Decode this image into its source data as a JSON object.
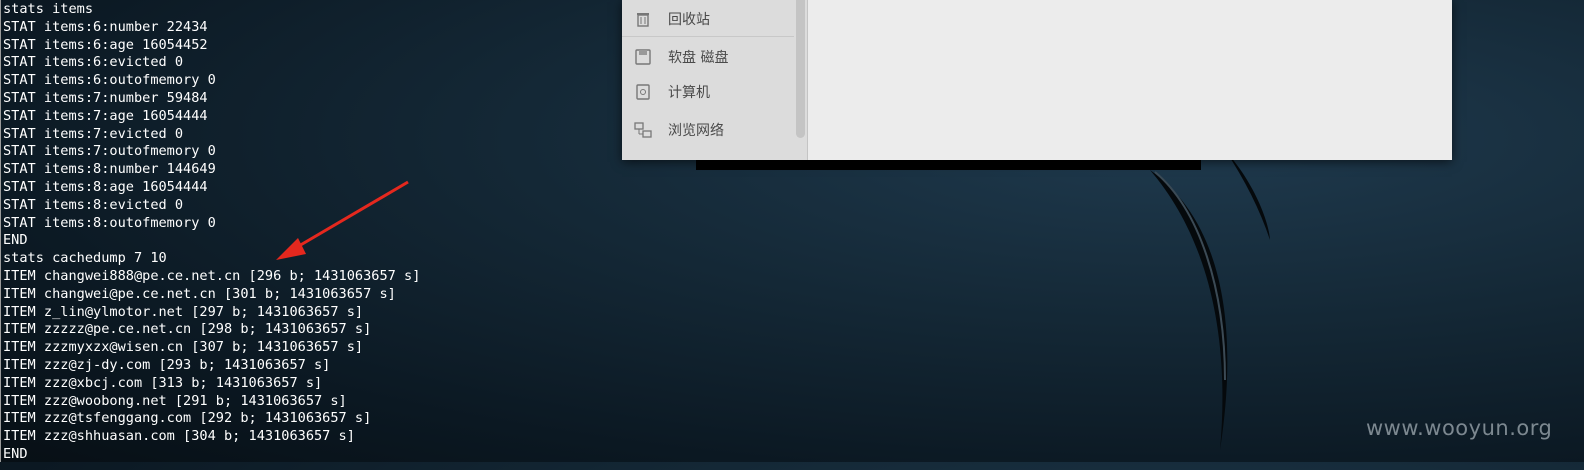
{
  "terminal": {
    "lines": [
      "stats items",
      "STAT items:6:number 22434",
      "STAT items:6:age 16054452",
      "STAT items:6:evicted 0",
      "STAT items:6:outofmemory 0",
      "STAT items:7:number 59484",
      "STAT items:7:age 16054444",
      "STAT items:7:evicted 0",
      "STAT items:7:outofmemory 0",
      "STAT items:8:number 144649",
      "STAT items:8:age 16054444",
      "STAT items:8:evicted 0",
      "STAT items:8:outofmemory 0",
      "END",
      "stats cachedump 7 10",
      "ITEM changwei888@pe.ce.net.cn [296 b; 1431063657 s]",
      "ITEM changwei@pe.ce.net.cn [301 b; 1431063657 s]",
      "ITEM z_lin@ylmotor.net [297 b; 1431063657 s]",
      "ITEM zzzzz@pe.ce.net.cn [298 b; 1431063657 s]",
      "ITEM zzzmyxzx@wisen.cn [307 b; 1431063657 s]",
      "ITEM zzz@zj-dy.com [293 b; 1431063657 s]",
      "ITEM zzz@xbcj.com [313 b; 1431063657 s]",
      "ITEM zzz@woobong.net [291 b; 1431063657 s]",
      "ITEM zzz@tsfenggang.com [292 b; 1431063657 s]",
      "ITEM zzz@shhuasan.com [304 b; 1431063657 s]",
      "END"
    ]
  },
  "file_manager": {
    "sidebar": [
      {
        "label": "回收站",
        "icon": "trash-icon"
      },
      {
        "label": "软盘 磁盘",
        "icon": "floppy-icon"
      },
      {
        "label": "计算机",
        "icon": "computer-icon"
      },
      {
        "label": "浏览网络",
        "icon": "network-icon"
      }
    ]
  },
  "watermark": "www.wooyun.org",
  "colors": {
    "terminal_text": "#ffffff",
    "annotation_arrow": "#e5281e",
    "desktop_bg": "#142836"
  }
}
